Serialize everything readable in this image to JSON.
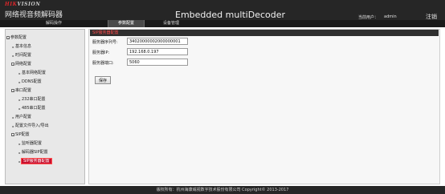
{
  "brand": {
    "logo_primary": "HIK",
    "logo_secondary": "VISION",
    "app_title": "网络视音频解码器",
    "logo_color": "#d8262b"
  },
  "header": {
    "product_title": "Embedded multiDecoder",
    "user_label": "当前用户：",
    "user_name": "admin",
    "logout_label": "注销"
  },
  "menu": {
    "items": [
      {
        "label": "解码操作",
        "active": false
      },
      {
        "label": "参数配置",
        "active": true
      },
      {
        "label": "设备管理",
        "active": false
      }
    ]
  },
  "sidebar": {
    "items": [
      {
        "label": "参数配置",
        "level": 0,
        "kind": "expander",
        "glyph": "−"
      },
      {
        "label": "基本信息",
        "level": 1,
        "kind": "leaf",
        "glyph": "▸"
      },
      {
        "label": "时间配置",
        "level": 1,
        "kind": "leaf",
        "glyph": "▸"
      },
      {
        "label": "网络配置",
        "level": 1,
        "kind": "expander",
        "glyph": "−"
      },
      {
        "label": "基本网络配置",
        "level": 2,
        "kind": "leaf",
        "glyph": "▸"
      },
      {
        "label": "DDNS配置",
        "level": 2,
        "kind": "leaf",
        "glyph": "▸"
      },
      {
        "label": "串口配置",
        "level": 1,
        "kind": "expander",
        "glyph": "−"
      },
      {
        "label": "232串口配置",
        "level": 2,
        "kind": "leaf",
        "glyph": "▸"
      },
      {
        "label": "485串口配置",
        "level": 2,
        "kind": "leaf",
        "glyph": "▸"
      },
      {
        "label": "用户配置",
        "level": 1,
        "kind": "leaf",
        "glyph": "▸"
      },
      {
        "label": "配置文件导入/导出",
        "level": 1,
        "kind": "leaf",
        "glyph": "▸"
      },
      {
        "label": "SIP配置",
        "level": 1,
        "kind": "expander",
        "glyph": "−"
      },
      {
        "label": "监听器配置",
        "level": 2,
        "kind": "leaf",
        "glyph": "▸"
      },
      {
        "label": "解码器SIP配置",
        "level": 2,
        "kind": "leaf",
        "glyph": "▸"
      },
      {
        "label": "SIP服务器配置",
        "level": 2,
        "kind": "leaf",
        "glyph": "▸",
        "selected": true
      }
    ],
    "selected_color": "#c8102e"
  },
  "main": {
    "section_title": "SIP服务器配置",
    "fields": [
      {
        "label": "服务器序列号:",
        "value": "34020000002000000001"
      },
      {
        "label": "服务器IP:",
        "value": "192.168.0.197"
      },
      {
        "label": "服务器端口:",
        "value": "5060"
      }
    ],
    "save_label": "保存"
  },
  "footer": {
    "text": "版权所有：杭州海康威视数字技术股份有限公司 Copyright© 2013-2017"
  }
}
